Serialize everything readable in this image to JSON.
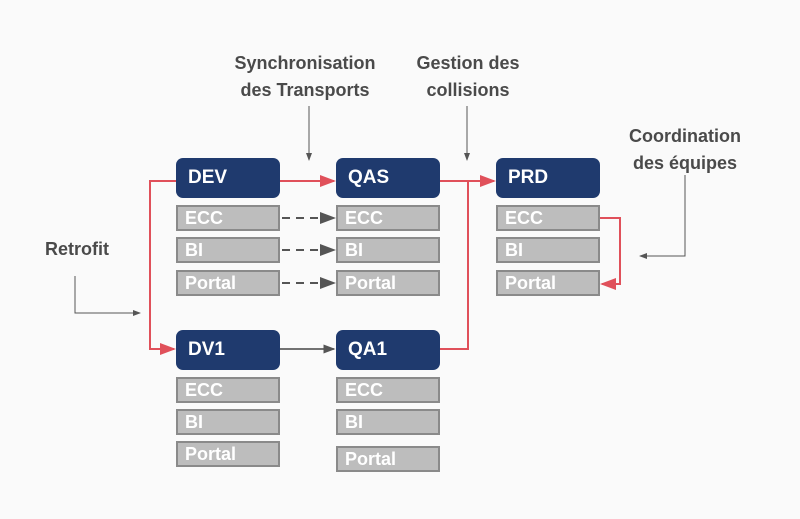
{
  "labels": {
    "sync": "Synchronisation\ndes Transports",
    "collisions": "Gestion des\ncollisions",
    "coordination": "Coordination\ndes équipes",
    "retrofit": "Retrofit"
  },
  "environments": {
    "dev": "DEV",
    "qas": "QAS",
    "prd": "PRD",
    "dv1": "DV1",
    "qa1": "QA1"
  },
  "components": {
    "ecc": "ECC",
    "bi": "BI",
    "portal": "Portal"
  },
  "colors": {
    "env": "#1f3a6e",
    "component": "#bdbdbd",
    "transport": "#e0505a",
    "annotation": "#4a4a4a"
  }
}
